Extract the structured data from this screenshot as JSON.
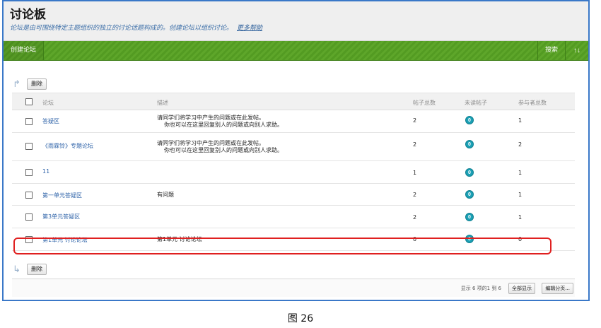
{
  "header": {
    "title": "讨论板",
    "description": "论坛是由可围绕特定主题组织的独立的讨论话题构成的。创建论坛以组织讨论。",
    "help_link": "更多帮助"
  },
  "toolbar": {
    "create_label": "创建论坛",
    "search_label": "搜索",
    "sort_label": "↑↓"
  },
  "bulk_actions": {
    "delete_label": "删除"
  },
  "table": {
    "columns": [
      "论坛",
      "描述",
      "帖子总数",
      "未读帖子",
      "参与者总数"
    ],
    "rows": [
      {
        "name": "答疑区",
        "desc_line1": "请同学们将学习中产生的问题或在此发帖。",
        "desc_line2": "你也可以在这里回复别人的问题或向别人求助。",
        "total": "2",
        "unread": "0",
        "participants": "1"
      },
      {
        "name": "《雨霖铃》专题论坛",
        "desc_line1": "请同学们将学习中产生的问题或在此发帖。",
        "desc_line2": "你也可以在这里回复别人的问题或向别人求助。",
        "total": "2",
        "unread": "0",
        "participants": "2"
      },
      {
        "name": "11",
        "desc_line1": "",
        "desc_line2": "",
        "total": "1",
        "unread": "0",
        "participants": "1"
      },
      {
        "name": "第一单元答疑区",
        "desc_line1": "有问题",
        "desc_line2": "",
        "total": "2",
        "unread": "0",
        "participants": "1"
      },
      {
        "name": "第3单元答疑区",
        "desc_line1": "",
        "desc_line2": "",
        "total": "2",
        "unread": "0",
        "participants": "1"
      },
      {
        "name": "第1单元 讨论论坛",
        "desc_line1": "第1单元 讨论论坛",
        "desc_line2": "",
        "total": "0",
        "unread": "0",
        "participants": "0"
      }
    ]
  },
  "footer": {
    "pager_text": "显示 6 项的1 到 6",
    "show_all_label": "全部显示",
    "edit_paging_label": "编辑分页..."
  },
  "caption": "图 26",
  "colors": {
    "toolbar_green": "#5ea62a",
    "frame_blue": "#3a78c8",
    "highlight_red": "#e02020",
    "badge_teal": "#1ba0b5",
    "link_blue": "#2d62a8"
  }
}
